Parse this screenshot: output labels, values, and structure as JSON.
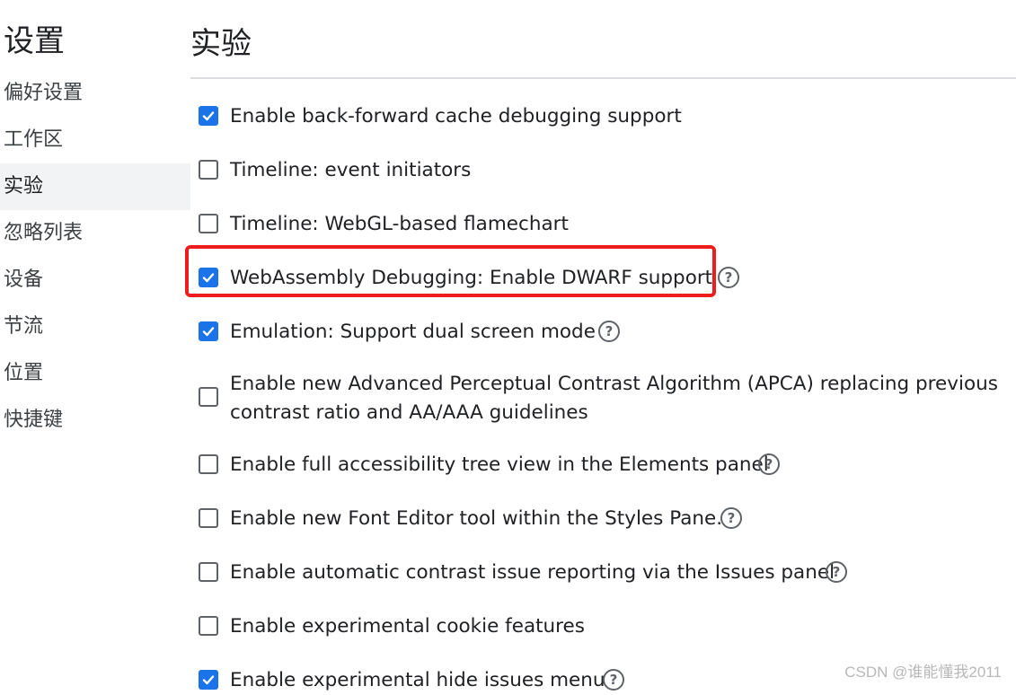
{
  "sidebar": {
    "title": "设置",
    "items": [
      {
        "label": "偏好设置",
        "selected": false
      },
      {
        "label": "工作区",
        "selected": false
      },
      {
        "label": "实验",
        "selected": true
      },
      {
        "label": "忽略列表",
        "selected": false
      },
      {
        "label": "设备",
        "selected": false
      },
      {
        "label": "节流",
        "selected": false
      },
      {
        "label": "位置",
        "selected": false
      },
      {
        "label": "快捷键",
        "selected": false
      }
    ]
  },
  "main": {
    "title": "实验",
    "experiments": [
      {
        "label": "Enable back-forward cache debugging support",
        "checked": true,
        "has_help": false
      },
      {
        "label": "Timeline: event initiators",
        "checked": false,
        "has_help": false
      },
      {
        "label": "Timeline: WebGL-based flamechart",
        "checked": false,
        "has_help": false
      },
      {
        "label": "WebAssembly Debugging: Enable DWARF support",
        "checked": true,
        "has_help": true
      },
      {
        "label": "Emulation: Support dual screen mode",
        "checked": true,
        "has_help": true
      },
      {
        "label": "Enable new Advanced Perceptual Contrast Algorithm (APCA) replacing previous contrast ratio and AA/AAA guidelines",
        "checked": false,
        "has_help": false
      },
      {
        "label": "Enable full accessibility tree view in the Elements panel",
        "checked": false,
        "has_help": true
      },
      {
        "label": "Enable new Font Editor tool within the Styles Pane.",
        "checked": false,
        "has_help": true
      },
      {
        "label": "Enable automatic contrast issue reporting via the Issues panel",
        "checked": false,
        "has_help": true
      },
      {
        "label": "Enable experimental cookie features",
        "checked": false,
        "has_help": false
      },
      {
        "label": "Enable experimental hide issues menu",
        "checked": true,
        "has_help": true
      }
    ],
    "help_glyph": "?"
  },
  "colors": {
    "accent": "#1a73e8",
    "highlight_border": "#ee1c1c",
    "selected_bg": "#f1f3f4"
  },
  "watermark": "CSDN @谁能懂我2011"
}
